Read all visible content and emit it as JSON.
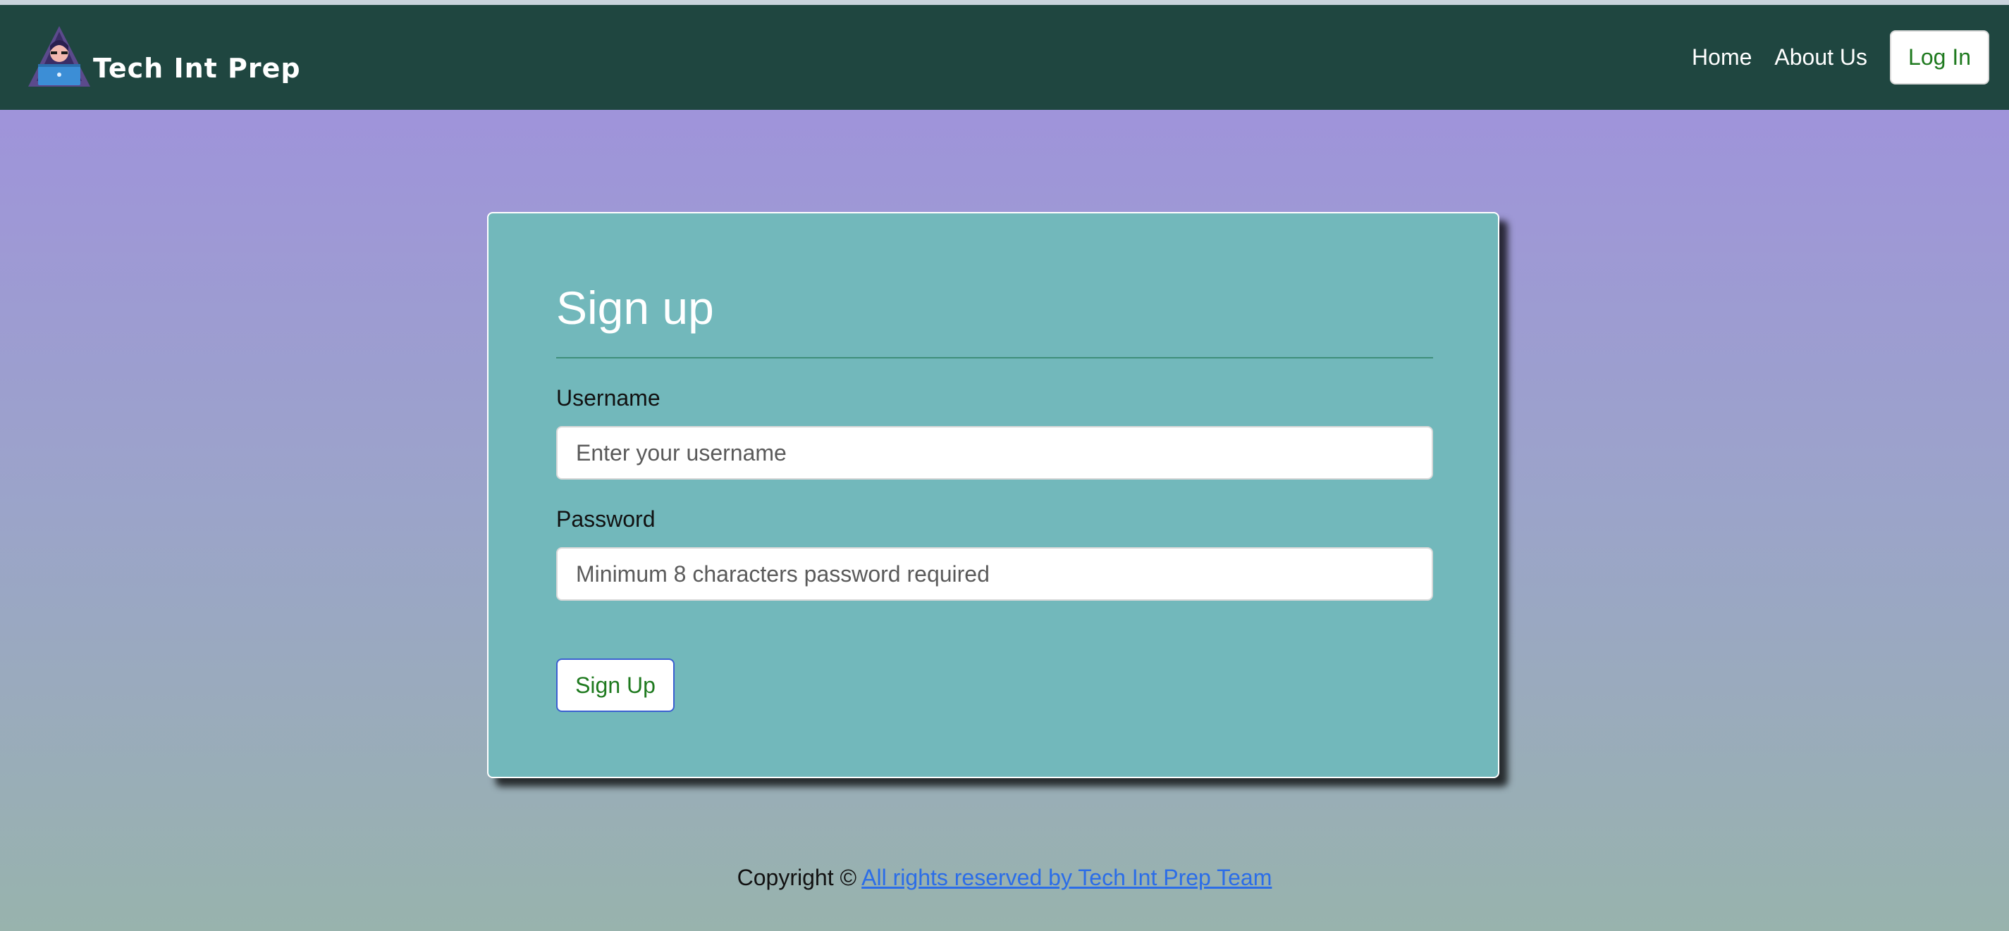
{
  "app": {
    "brand_name": "Tech Int Prep",
    "logo_icon": "hacker-avatar-logo-icon"
  },
  "nav": {
    "links": [
      {
        "label": "Home"
      },
      {
        "label": "About Us"
      }
    ],
    "login_label": "Log In"
  },
  "form": {
    "title": "Sign up",
    "username": {
      "label": "Username",
      "value": "",
      "placeholder": "Enter your username"
    },
    "password": {
      "label": "Password",
      "value": "",
      "placeholder": "Minimum 8 characters password required"
    },
    "submit_label": "Sign Up"
  },
  "footer": {
    "prefix": "Copyright ©",
    "link_text": "All rights reserved by Tech Int Prep Team"
  },
  "colors": {
    "navbar": "#1f4640",
    "card": "#72b8bb",
    "gradient_top": "#a08fdf",
    "gradient_bottom": "#98b3ad",
    "button_text": "#1f7a1f",
    "link": "#2b6de8"
  }
}
